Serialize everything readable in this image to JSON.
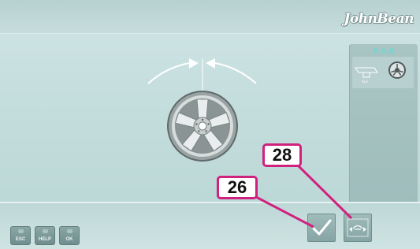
{
  "brand": {
    "logo_text": "JohnBean"
  },
  "side_panel": {
    "value_display": "0.0.0",
    "icons": [
      "balancer-icon",
      "wheel-icon"
    ]
  },
  "keys": {
    "esc_label": "ESC",
    "help_label": "HELP",
    "ok_label": "OK"
  },
  "actions": {
    "confirm_icon": "checkmark-icon",
    "next_icon": "wheel-shift-icon"
  },
  "callouts": {
    "first": "26",
    "second": "28"
  },
  "colors": {
    "background": "#c3dddc",
    "panel": "#a9c4c3",
    "callout_border": "#d0217e",
    "button": "#8aa6a5"
  }
}
